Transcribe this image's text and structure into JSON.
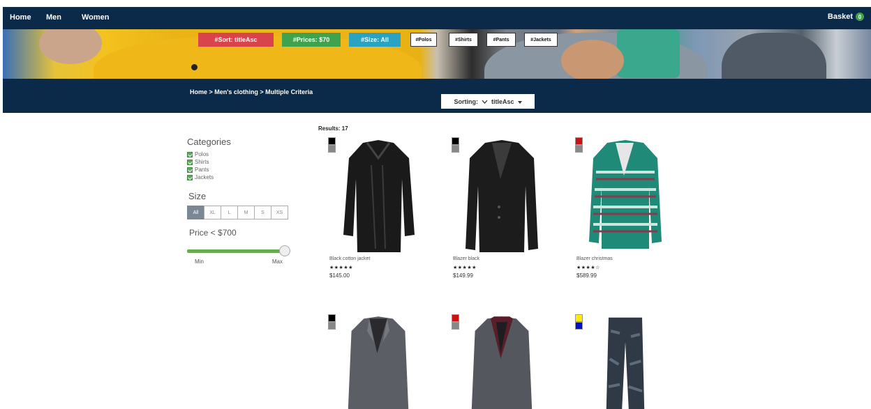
{
  "nav": {
    "links": [
      "Home",
      "Men",
      "Women"
    ],
    "basket_label": "Basket",
    "basket_count": "0"
  },
  "filters": {
    "chips": [
      {
        "label": "#Sort: titleAsc",
        "color": "#d9434b"
      },
      {
        "label": "#Prices: $70",
        "color": "#3fa34d"
      },
      {
        "label": "#Size: All",
        "color": "#2aa3c3"
      }
    ],
    "category_chips": [
      "#Polos",
      "#Shirts",
      "#Pants",
      "#Jackets"
    ]
  },
  "breadcrumb": "Home > Men's clothing > Multiple Criteria",
  "sorting": {
    "label": "Sorting:",
    "value": "titleAsc"
  },
  "sidebar": {
    "categories_heading": "Categories",
    "categories": [
      "Polos",
      "Shirts",
      "Pants",
      "Jackets"
    ],
    "size_heading": "Size",
    "sizes": [
      "All",
      "XL",
      "L",
      "M",
      "S",
      "XS"
    ],
    "active_size": "All",
    "price_heading": "Price < $700",
    "price_fill_fraction": 0.97,
    "min_label": "Min",
    "max_label": "Max"
  },
  "results_label": "Results: 17",
  "products": [
    {
      "name": "Black cotton jacket",
      "stars": "★★★★★",
      "price": "$145.00",
      "swatches": [
        "#000000",
        "#888888"
      ],
      "garment": "jacket-black"
    },
    {
      "name": "Blazer black",
      "stars": "★★★★★",
      "price": "$149.99",
      "swatches": [
        "#000000",
        "#888888"
      ],
      "garment": "blazer-black"
    },
    {
      "name": "Blazer christmas",
      "stars": "★★★★☆",
      "price": "$589.99",
      "swatches": [
        "#cc1111",
        "#888888"
      ],
      "garment": "blazer-christmas"
    },
    {
      "name": "",
      "stars": "",
      "price": "",
      "swatches": [
        "#000000",
        "#888888"
      ],
      "garment": "blazer-grey"
    },
    {
      "name": "",
      "stars": "",
      "price": "",
      "swatches": [
        "#cc1111",
        "#888888"
      ],
      "garment": "blazer-grey-burgundy"
    },
    {
      "name": "",
      "stars": "",
      "price": "",
      "swatches": [
        "#ffee00",
        "#0011cc"
      ],
      "garment": "pants-camo"
    }
  ],
  "colors": {
    "navy": "#0b2a4a",
    "green": "#3fa34d",
    "red": "#d9434b",
    "teal": "#2aa3c3"
  }
}
